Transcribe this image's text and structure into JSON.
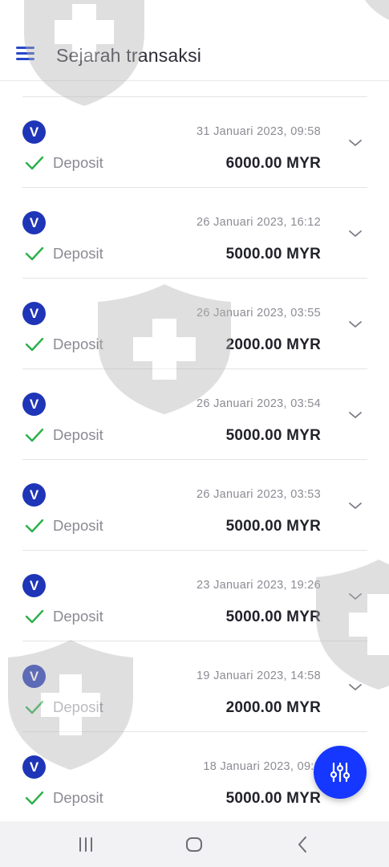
{
  "header": {
    "title": "Sejarah transaksi",
    "menu_icon": "hamburger-icon"
  },
  "colors": {
    "accent": "#1537ff",
    "badge": "#1f35b8",
    "success": "#2bb04a"
  },
  "transactions": [
    {
      "badge": "V",
      "type": "Deposit",
      "date": "31 Januari 2023, 09:58",
      "amount": "6000.00 MYR"
    },
    {
      "badge": "V",
      "type": "Deposit",
      "date": "26 Januari 2023, 16:12",
      "amount": "5000.00 MYR"
    },
    {
      "badge": "V",
      "type": "Deposit",
      "date": "26 Januari 2023, 03:55",
      "amount": "2000.00 MYR"
    },
    {
      "badge": "V",
      "type": "Deposit",
      "date": "26 Januari 2023, 03:54",
      "amount": "5000.00 MYR"
    },
    {
      "badge": "V",
      "type": "Deposit",
      "date": "26 Januari 2023, 03:53",
      "amount": "5000.00 MYR"
    },
    {
      "badge": "V",
      "type": "Deposit",
      "date": "23 Januari 2023, 19:26",
      "amount": "5000.00 MYR"
    },
    {
      "badge": "V",
      "type": "Deposit",
      "date": "19 Januari 2023, 14:58",
      "amount": "2000.00 MYR"
    },
    {
      "badge": "V",
      "type": "Deposit",
      "date": "18 Januari 2023, 09:3",
      "amount": "5000.00 MYR"
    }
  ],
  "fab": {
    "icon": "filter-sliders-icon"
  },
  "nav": {
    "recents_icon": "recent-apps-icon",
    "home_icon": "home-icon",
    "back_icon": "back-icon"
  }
}
